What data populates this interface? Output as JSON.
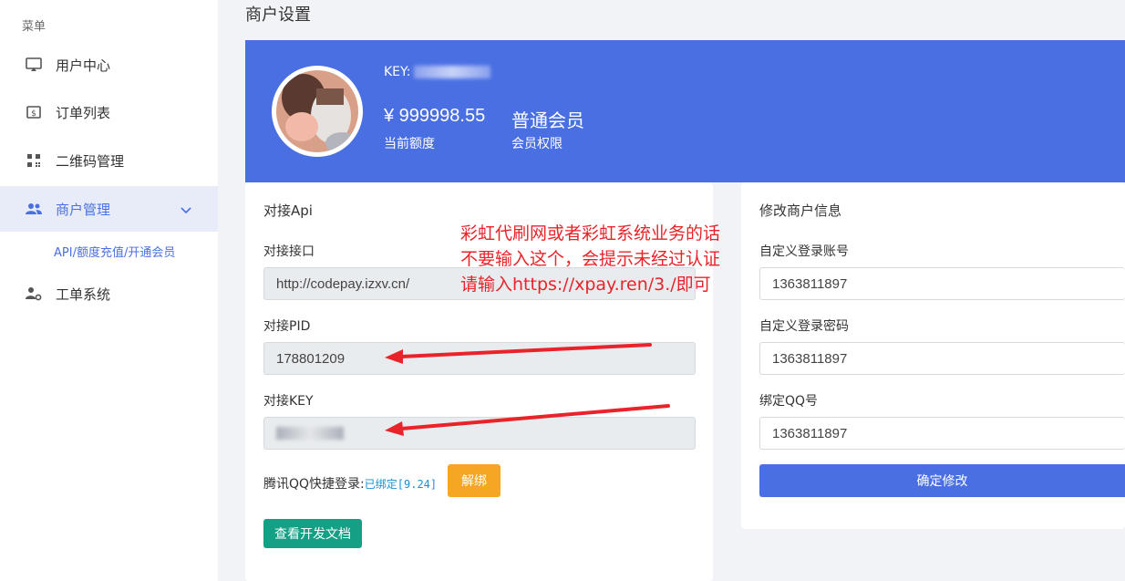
{
  "sidebar": {
    "menu_title": "菜单",
    "items": [
      {
        "label": "用户中心",
        "icon": "monitor-icon"
      },
      {
        "label": "订单列表",
        "icon": "dollar-receipt-icon"
      },
      {
        "label": "二维码管理",
        "icon": "qrcode-icon"
      },
      {
        "label": "商户管理",
        "icon": "users-icon",
        "active": true
      },
      {
        "label": "工单系统",
        "icon": "user-gear-icon"
      }
    ],
    "sub_item": "API/额度充值/开通会员"
  },
  "page_title": "商户设置",
  "banner": {
    "key_label": "KEY:",
    "amount": "¥ 999998.55",
    "amount_label": "当前额度",
    "level": "普通会员",
    "level_label": "会员权限",
    "color": "#4a6fe3"
  },
  "api_card": {
    "title": "对接Api",
    "endpoint_label": "对接接口",
    "endpoint_value": "http://codepay.izxv.cn/",
    "pid_label": "对接PID",
    "pid_value": "178801209",
    "key_label": "对接KEY",
    "qq_label": "腾讯QQ快捷登录:",
    "qq_status": "已绑定[9.24]",
    "unbind_button": "解绑",
    "docs_button": "查看开发文档"
  },
  "merchant_card": {
    "title": "修改商户信息",
    "account_label": "自定义登录账号",
    "account_value": "1363811897",
    "password_label": "自定义登录密码",
    "password_value": "1363811897",
    "qq_label": "绑定QQ号",
    "qq_value": "1363811897",
    "submit_button": "确定修改"
  },
  "annotation": {
    "lines": [
      "彩虹代刷网或者彩虹系统业务的话",
      "不要输入这个，会提示未经过认证",
      "请输入https://xpay.ren/3./即可"
    ],
    "color": "#e8242a"
  },
  "colors": {
    "primary": "#4a6fe3",
    "warning": "#f5a623",
    "teal": "#14a085",
    "submit": "#4a6fe3"
  }
}
